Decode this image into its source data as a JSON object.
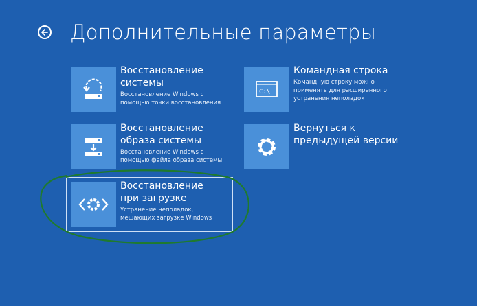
{
  "page": {
    "title": "Дополнительные параметры",
    "back_icon": "back-arrow-icon"
  },
  "options": {
    "system_restore": {
      "icon": "system-restore-icon",
      "name": "Восстановление системы",
      "desc": "Восстановление Windows с помощью точки восстановления"
    },
    "image_recovery": {
      "icon": "image-recovery-icon",
      "name": "Восстановление образа системы",
      "desc": "Восстановление Windows с помощью файла образа системы"
    },
    "startup_repair": {
      "icon": "startup-repair-icon",
      "name": "Восстановление при загрузке",
      "desc": "Устранение неполадок, мешающих загрузке Windows"
    },
    "command_prompt": {
      "icon": "command-prompt-icon",
      "name": "Командная строка",
      "desc": "Командную строку можно применять для расширенного устранения неполадок",
      "tile_text": "C:\\"
    },
    "previous_version": {
      "icon": "gear-icon",
      "name": "Вернуться к предыдущей версии",
      "desc": ""
    }
  },
  "colors": {
    "background": "#1e5fb0",
    "tile": "#4a90d9",
    "annotation": "#1f7a2e"
  }
}
